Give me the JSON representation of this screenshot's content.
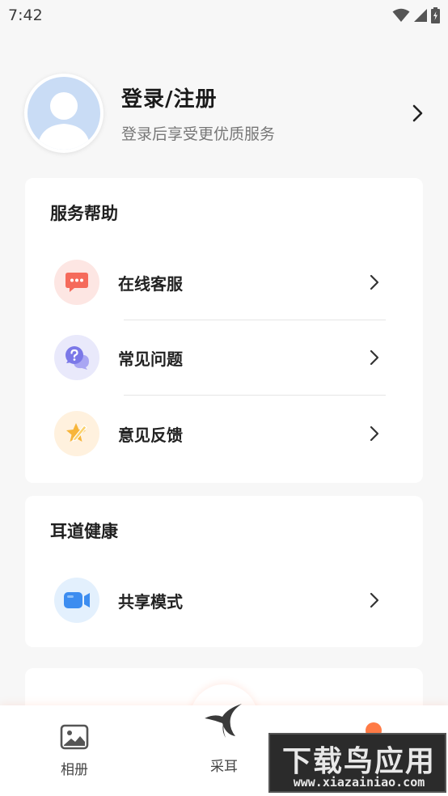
{
  "status_bar": {
    "time": "7:42"
  },
  "profile": {
    "title": "登录/注册",
    "subtitle": "登录后享受更优质服务"
  },
  "service_section": {
    "title": "服务帮助",
    "items": [
      {
        "label": "在线客服",
        "icon": "chat-bubble-icon",
        "icon_bg": "#fde6e3",
        "icon_color": "#f56a5b"
      },
      {
        "label": "常见问题",
        "icon": "question-bubble-icon",
        "icon_bg": "#e9e9fb",
        "icon_color": "#7b78e8"
      },
      {
        "label": "意见反馈",
        "icon": "star-pen-icon",
        "icon_bg": "#fff1de",
        "icon_color": "#f7b53a"
      }
    ]
  },
  "ear_section": {
    "title": "耳道健康",
    "items": [
      {
        "label": "共享模式",
        "icon": "video-camera-icon",
        "icon_bg": "#e3f0fd",
        "icon_color": "#3d8df0"
      }
    ]
  },
  "tabbar": {
    "tabs": [
      {
        "label": "相册",
        "icon": "image-icon"
      },
      {
        "label": "采耳",
        "icon": "bird-logo-icon"
      },
      {
        "label": "",
        "icon": "profile-icon",
        "active_color": "#ff7a45"
      }
    ]
  },
  "watermark": {
    "main": "下载鸟应用",
    "url": "www.xiazainiao.com"
  },
  "colors": {
    "background": "#f7f7f7",
    "accent": "#ff7a45",
    "card": "#ffffff"
  }
}
